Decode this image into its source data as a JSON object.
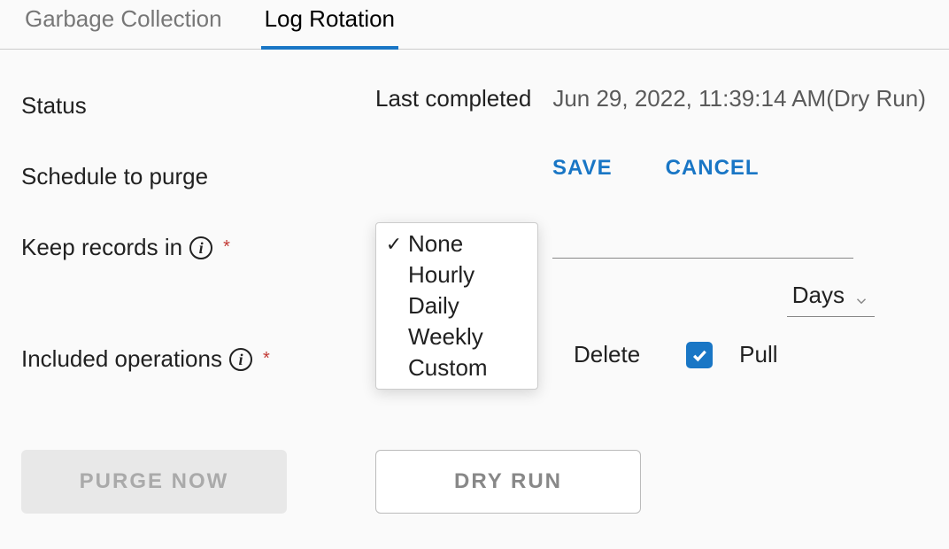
{
  "tabs": {
    "gc": "Garbage Collection",
    "log_rotation": "Log Rotation"
  },
  "status": {
    "label": "Status",
    "last_completed_label": "Last completed",
    "last_completed_value": "Jun 29, 2022, 11:39:14 AM(Dry Run)"
  },
  "schedule": {
    "label": "Schedule to purge",
    "save": "SAVE",
    "cancel": "CANCEL",
    "options": {
      "none": "None",
      "hourly": "Hourly",
      "daily": "Daily",
      "weekly": "Weekly",
      "custom": "Custom"
    },
    "selected": "None"
  },
  "keep_records": {
    "label": "Keep records in",
    "unit": "Days"
  },
  "included_ops": {
    "label": "Included operations",
    "delete": "Delete",
    "pull": "Pull"
  },
  "buttons": {
    "purge_now": "PURGE NOW",
    "dry_run": "DRY RUN"
  }
}
